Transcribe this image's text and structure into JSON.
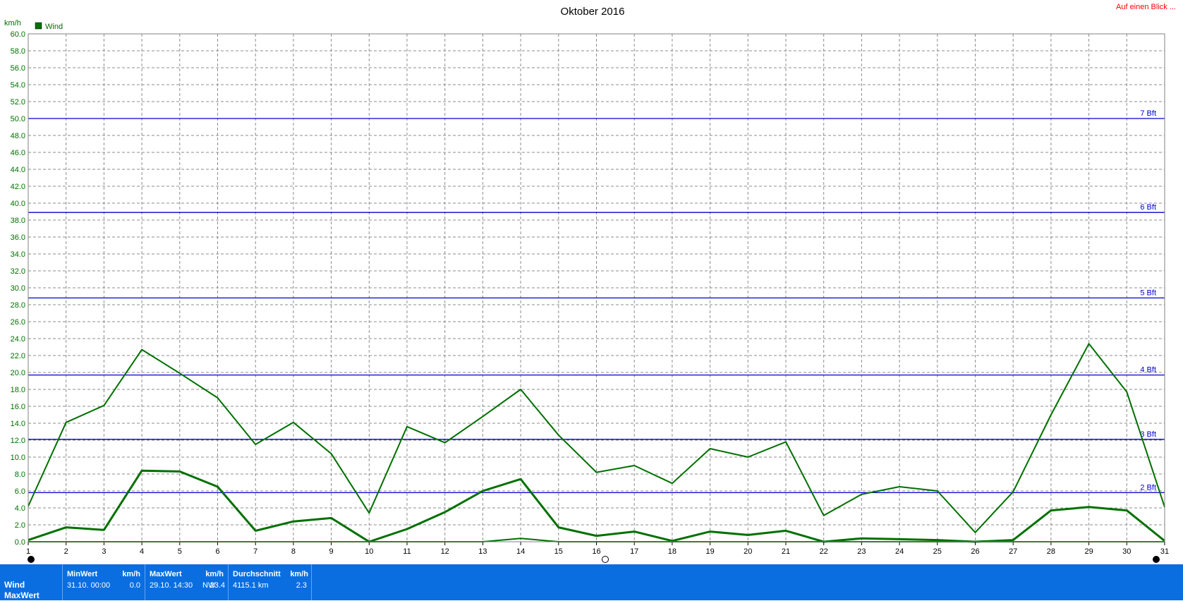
{
  "header": {
    "link_text": "Auf einen Blick ..."
  },
  "chart_data": {
    "type": "line",
    "title": "Oktober 2016",
    "ylabel": "km/h",
    "legend": [
      {
        "label": "Wind",
        "color": "#007000"
      }
    ],
    "legend_placement": "top-left",
    "grid": true,
    "x": [
      1,
      2,
      3,
      4,
      5,
      6,
      7,
      8,
      9,
      10,
      11,
      12,
      13,
      14,
      15,
      16,
      17,
      18,
      19,
      20,
      21,
      22,
      23,
      24,
      25,
      26,
      27,
      28,
      29,
      30,
      31
    ],
    "xlim": [
      1,
      31
    ],
    "ylim": [
      0,
      60
    ],
    "ytick_step": 2,
    "series": [
      {
        "name": "Wind",
        "style": "max",
        "color": "#007000",
        "values": [
          4.2,
          14.1,
          16.1,
          22.7,
          19.9,
          17.0,
          11.5,
          14.1,
          10.4,
          3.4,
          13.6,
          11.7,
          14.8,
          18.0,
          12.6,
          8.2,
          9.0,
          6.9,
          11.0,
          10.0,
          11.8,
          3.1,
          5.6,
          6.5,
          6.0,
          1.1,
          5.9,
          15.0,
          23.4,
          17.7,
          4.1
        ]
      },
      {
        "name": "Wind",
        "style": "avg",
        "color": "#007000",
        "values": [
          0.2,
          1.7,
          1.4,
          8.4,
          8.3,
          6.5,
          1.3,
          2.4,
          2.8,
          0.0,
          1.5,
          3.5,
          6.0,
          7.4,
          1.7,
          0.7,
          1.2,
          0.1,
          1.2,
          0.8,
          1.3,
          0.0,
          0.4,
          0.3,
          0.2,
          0.0,
          0.2,
          3.7,
          4.1,
          3.7,
          0.1
        ]
      },
      {
        "name": "Wind",
        "style": "min",
        "color": "#007000",
        "values": [
          0,
          0,
          0,
          0,
          0,
          0,
          0,
          0,
          0,
          0,
          0,
          0,
          0,
          0.4,
          0,
          0,
          0,
          0,
          0,
          0,
          0,
          0,
          0,
          0,
          0,
          0,
          0,
          0,
          0,
          0,
          0
        ]
      }
    ],
    "reference_lines": [
      {
        "label": "2 Bft",
        "y": 5.8
      },
      {
        "label": "3 Bft",
        "y": 12.1
      },
      {
        "label": "4 Bft",
        "y": 19.7
      },
      {
        "label": "5 Bft",
        "y": 28.8
      },
      {
        "label": "6 Bft",
        "y": 38.9
      },
      {
        "label": "7 Bft",
        "y": 50.0
      }
    ],
    "reference_color": "#0000d0"
  },
  "stats": {
    "row_labels": [
      "Wind",
      "MaxWert"
    ],
    "min": {
      "header": "MinWert",
      "unit": "km/h",
      "date": "31.10.  00:00",
      "value": "0.0"
    },
    "max": {
      "header": "MaxWert",
      "unit": "km/h",
      "date": "29.10.  14:30",
      "dir": "NW",
      "value": "23.4"
    },
    "avg": {
      "header": "Durchschnitt",
      "unit": "km/h",
      "total": "4115.1 km",
      "value": "2.3"
    }
  }
}
